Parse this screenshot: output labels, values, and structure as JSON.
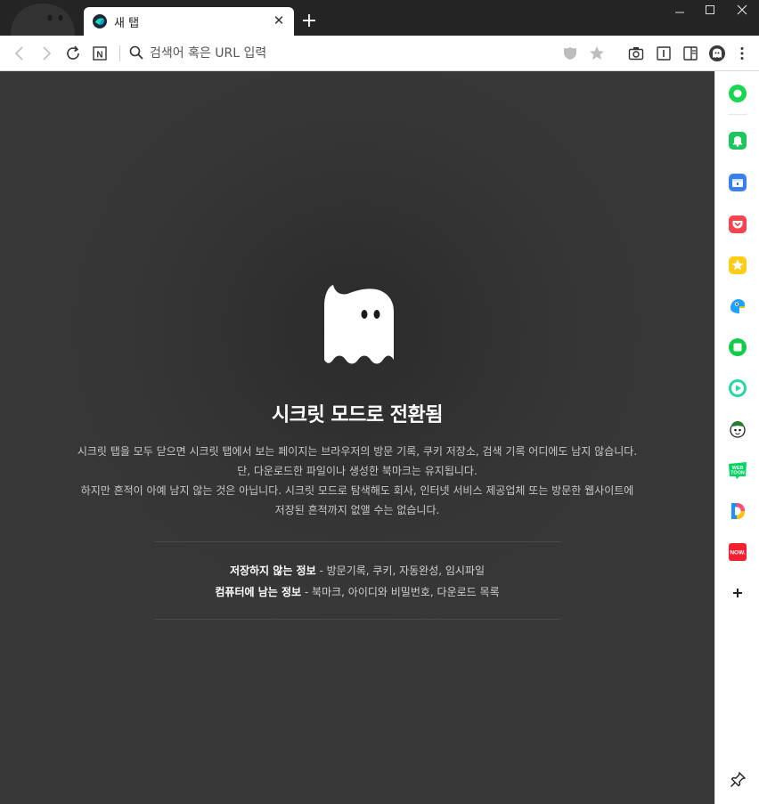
{
  "tab": {
    "title": "새 탭",
    "close": "✕"
  },
  "new_tab": "+",
  "window": {
    "minimize": "—",
    "maximize": "☐",
    "close": "✕"
  },
  "toolbar": {
    "address_placeholder": "검색어 혹은 URL 입력",
    "naver_label": "N"
  },
  "main": {
    "title": "시크릿 모드로 전환됨",
    "desc_lines": [
      "시크릿 탭을 모두 닫으면 시크릿 탭에서 보는 페이지는 브라우저의 방문 기록, 쿠키 저장소, 검색 기록 어디에도 남지 않습니다.",
      "단, 다운로드한 파일이나 생성한 북마크는 유지됩니다.",
      "하지만 흔적이 아예 남지 않는 것은 아닙니다. 시크릿 모드로 탐색해도 회사, 인터넷 서비스 제공업체 또는 방문한 웹사이트에",
      "저장된 흔적까지 없앨 수는 없습니다."
    ],
    "not_saved_label": "저장하지 않는 정보",
    "not_saved_value": " - 방문기록, 쿠키, 자동완성, 임시파일",
    "remaining_label": "컴퓨터에 남는 정보",
    "remaining_value": " - 북마크, 아이디와 비밀번호, 다운로드 목록"
  },
  "sidebar": {
    "items": [
      "green-ring-icon",
      "notification-bell-icon",
      "calendar-icon",
      "pocket-icon",
      "favorites-star-icon",
      "papago-icon",
      "green-square-icon",
      "play-icon",
      "character-face-icon",
      "webtoon-icon",
      "dictionary-icon",
      "now-icon",
      "add-icon"
    ],
    "webtoon_label": "WEB TOON",
    "now_label": "NOW.",
    "add_label": "+"
  },
  "colors": {
    "accent_green": "#00c73c",
    "dark_bg": "#383838",
    "titlebar": "#242424"
  }
}
